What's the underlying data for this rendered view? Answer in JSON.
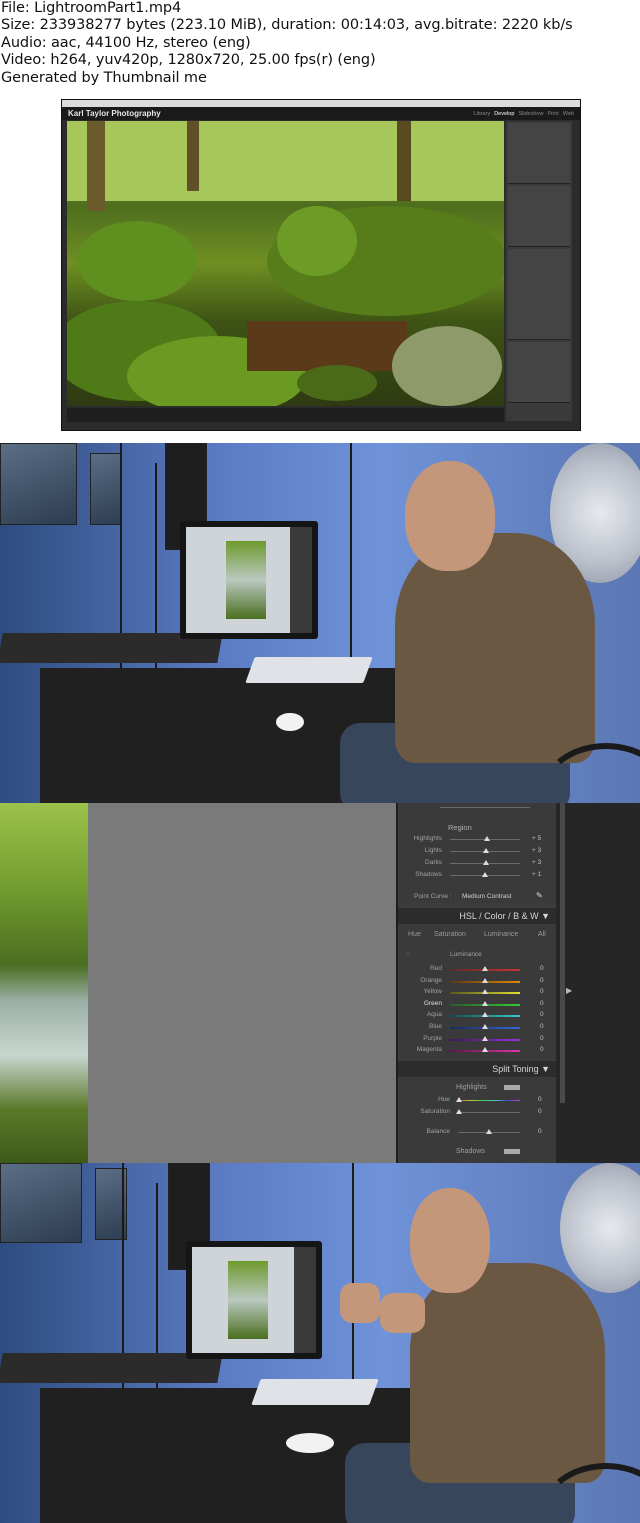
{
  "info": {
    "line1": "File: LightroomPart1.mp4",
    "line2": "Size: 233938277 bytes (223.10 MiB), duration: 00:14:03, avg.bitrate: 2220 kb/s",
    "line3": "Audio: aac, 44100 Hz, stereo (eng)",
    "line4": "Video: h264, yuv420p, 1280x720, 25.00 fps(r) (eng)",
    "line5": "Generated by Thumbnail me"
  },
  "lightroom": {
    "identity": "Karl Taylor Photography",
    "modules": [
      "Library",
      "Develop",
      "Slideshow",
      "Print",
      "Web"
    ],
    "active_module": "Develop"
  },
  "zoom_panel": {
    "region_label": "Region",
    "tone_rows": [
      {
        "label": "Highlights",
        "value": "+ 5"
      },
      {
        "label": "Lights",
        "value": "+ 3"
      },
      {
        "label": "Darks",
        "value": "+ 3"
      },
      {
        "label": "Shadows",
        "value": "+ 1"
      }
    ],
    "point_curve_label": "Point Curve :",
    "point_curve_value": "Medium Contrast",
    "hsl_title": "HSL  /  Color  /  B & W  ▼",
    "hsl_tabs": [
      "Hue",
      "Saturation",
      "Luminance",
      "All"
    ],
    "hsl_active_tab": "Luminance",
    "luminance_label": "Luminance",
    "luminance_rows": [
      {
        "label": "Red",
        "value": "0"
      },
      {
        "label": "Orange",
        "value": "0"
      },
      {
        "label": "Yellow",
        "value": "0"
      },
      {
        "label": "Green",
        "value": "0"
      },
      {
        "label": "Aqua",
        "value": "0"
      },
      {
        "label": "Blue",
        "value": "0"
      },
      {
        "label": "Purple",
        "value": "0"
      },
      {
        "label": "Magenta",
        "value": "0"
      }
    ],
    "split_toning_title": "Split Toning  ▼",
    "highlights_label": "Highlights",
    "hue_label": "Hue",
    "hue_value": "0",
    "saturation_label": "Saturation",
    "saturation_value": "0",
    "balance_label": "Balance",
    "balance_value": "0",
    "shadows_label": "Shadows"
  },
  "colors": {
    "panel_bg": "#3c3c3c",
    "studio_wall": "#5b7cc4"
  }
}
